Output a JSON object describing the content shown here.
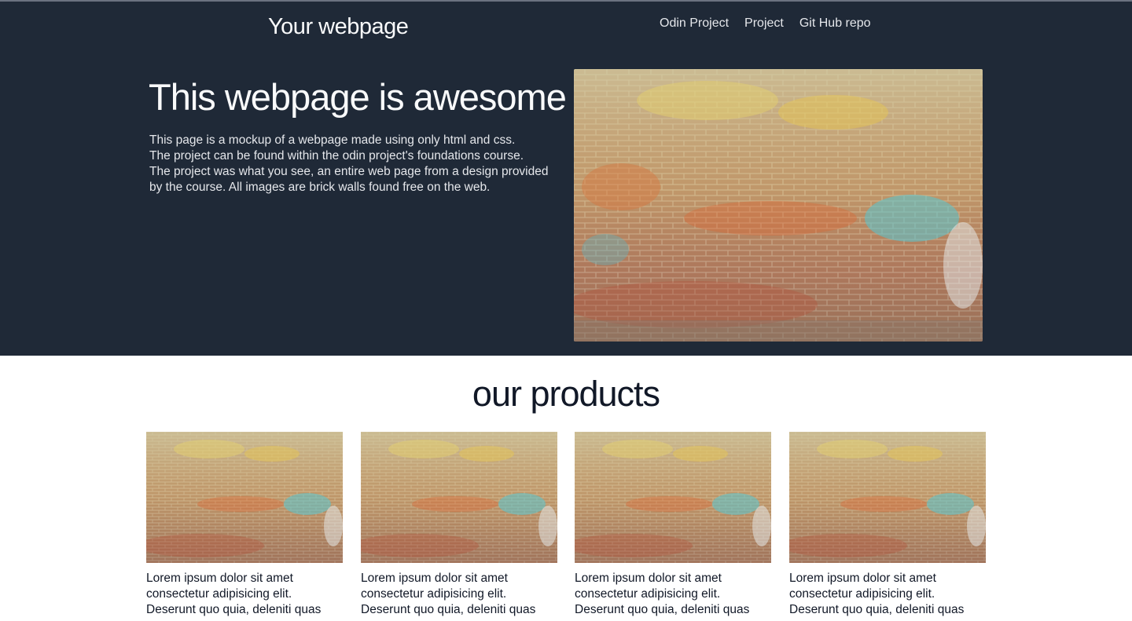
{
  "header": {
    "logo": "Your webpage",
    "nav": [
      "Odin Project",
      "Project",
      "Git Hub repo"
    ]
  },
  "hero": {
    "title": "This webpage is awesome",
    "lines": [
      "This page is a mockup of a webpage made using only html and css.",
      "The project can be found within the odin project's foundations course.",
      "The project was what you see, an entire web page from a design provided",
      "by the course. All images are brick walls found free on the web."
    ]
  },
  "products": {
    "title": "our products",
    "items": [
      {
        "lines": [
          "Lorem ipsum dolor sit amet",
          "consectetur adipisicing elit.",
          "Deserunt quo quia, deleniti quas"
        ]
      },
      {
        "lines": [
          "Lorem ipsum dolor sit amet",
          "consectetur adipisicing elit.",
          "Deserunt quo quia, deleniti quas"
        ]
      },
      {
        "lines": [
          "Lorem ipsum dolor sit amet",
          "consectetur adipisicing elit.",
          "Deserunt quo quia, deleniti quas"
        ]
      },
      {
        "lines": [
          "Lorem ipsum dolor sit amet",
          "consectetur adipisicing elit.",
          "Deserunt quo quia, deleniti quas"
        ]
      }
    ]
  },
  "colors": {
    "hero_bg": "#1f2937",
    "hero_text": "#f9fafb",
    "body_text": "#111827"
  }
}
